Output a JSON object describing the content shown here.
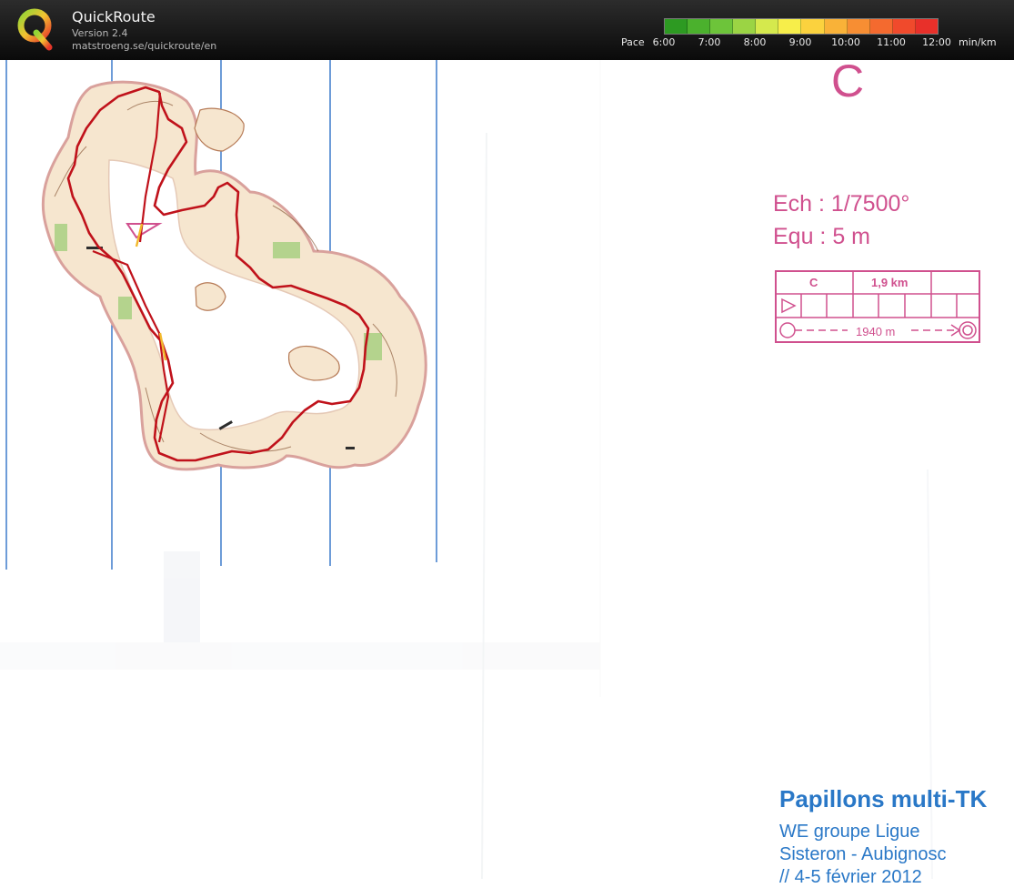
{
  "app": {
    "title": "QuickRoute",
    "version": "Version 2.4",
    "url": "matstroeng.se/quickroute/en",
    "logo_letter": "Q"
  },
  "pace_legend": {
    "label": "Pace",
    "unit": "min/km",
    "ticks": [
      "6:00",
      "7:00",
      "8:00",
      "9:00",
      "10:00",
      "11:00",
      "12:00"
    ],
    "gradient_colors": [
      "#2d9a22",
      "#4bb12d",
      "#6dc43a",
      "#9bd444",
      "#d5e94d",
      "#f7ee4a",
      "#fbd23e",
      "#f9b238",
      "#f78e33",
      "#f46a2f",
      "#f04a2c",
      "#e8302a"
    ]
  },
  "map": {
    "course_letter": "C",
    "scale": "Ech : 1/7500°",
    "equidistance": "Equ : 5 m",
    "control_box": {
      "course": "C",
      "distance": "1,9 km",
      "route_length": "1940 m"
    },
    "event": {
      "title": "Papillons multi-TK",
      "line1": "WE groupe Ligue",
      "line2": "Sisteron - Aubignosc",
      "line3": "// 4-5 février 2012"
    },
    "colors": {
      "route": "#c0121b",
      "course_print": "#d0508e",
      "north_lines": "#1f66c4",
      "event_text": "#2a78c7"
    }
  }
}
